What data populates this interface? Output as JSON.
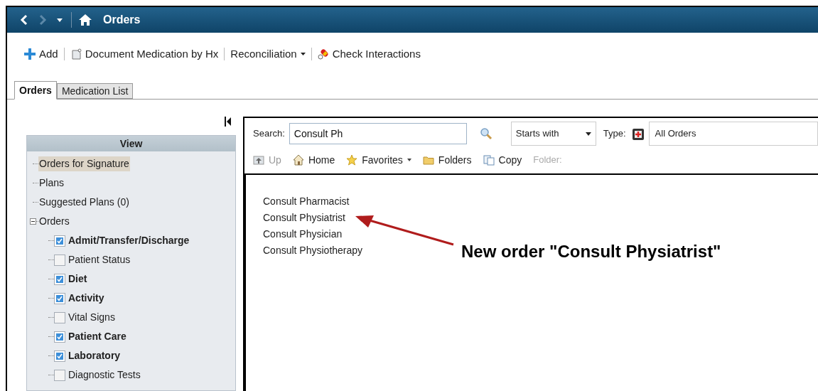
{
  "window": {
    "title": "Orders"
  },
  "toolbar": [
    {
      "kind": "add",
      "label": "Add"
    },
    {
      "kind": "document",
      "label": "Document Medication by Hx"
    },
    {
      "kind": "menu",
      "label": "Reconciliation"
    },
    {
      "kind": "interactions",
      "label": "Check Interactions"
    }
  ],
  "tabs": [
    {
      "label": "Orders",
      "selected": true
    },
    {
      "label": "Medication List",
      "selected": false
    }
  ],
  "view": {
    "title": "View",
    "items": [
      {
        "label": "Orders for Signature",
        "selected": true
      },
      {
        "label": "Plans",
        "selected": false
      },
      {
        "label": "Suggested Plans (0)",
        "selected": false
      },
      {
        "label": "Orders",
        "selected": false,
        "expanded": true,
        "children": [
          {
            "label": "Admit/Transfer/Discharge",
            "checked": true
          },
          {
            "label": "Patient Status",
            "checked": false
          },
          {
            "label": "Diet",
            "checked": true
          },
          {
            "label": "Activity",
            "checked": true
          },
          {
            "label": "Vital Signs",
            "checked": false
          },
          {
            "label": "Patient Care",
            "checked": true
          },
          {
            "label": "Laboratory",
            "checked": true
          },
          {
            "label": "Diagnostic Tests",
            "checked": false
          }
        ]
      }
    ]
  },
  "search": {
    "label": "Search:",
    "value": "Consult Ph",
    "mode": "Starts with",
    "type_label": "Type:",
    "type_value": "All Orders"
  },
  "nav": [
    {
      "kind": "up",
      "label": "Up",
      "disabled": true
    },
    {
      "kind": "home",
      "label": "Home",
      "disabled": false
    },
    {
      "kind": "favorites",
      "label": "Favorites",
      "disabled": false
    },
    {
      "kind": "folders",
      "label": "Folders",
      "disabled": false
    },
    {
      "kind": "copy",
      "label": "Copy",
      "disabled": false
    }
  ],
  "folder_label": "Folder:",
  "results": [
    "Consult Pharmacist",
    "Consult Physiatrist",
    "Consult Physician",
    "Consult Physiotherapy"
  ],
  "annotation": "New order \"Consult Physiatrist\""
}
